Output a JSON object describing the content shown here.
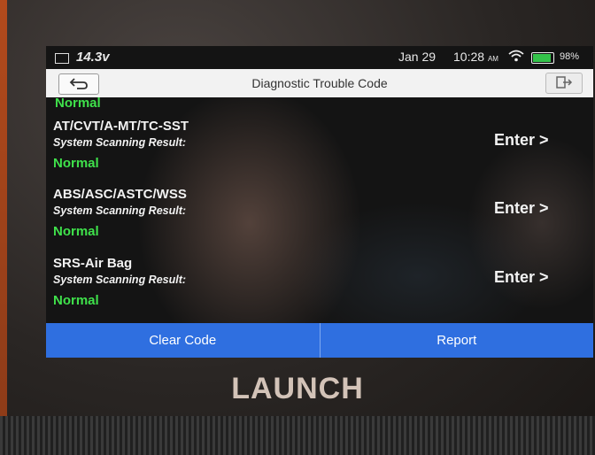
{
  "status_bar": {
    "voltage": "14.3v",
    "date": "Jan 29",
    "time": "10:28",
    "time_suffix": "AM",
    "battery_percent": "98%",
    "battery_level": 0.98
  },
  "title_bar": {
    "title": "Diagnostic Trouble Code"
  },
  "list": {
    "partial_status": "Normal",
    "items": [
      {
        "name": "AT/CVT/A-MT/TC-SST",
        "label": "System Scanning Result:",
        "status": "Normal",
        "action": "Enter >"
      },
      {
        "name": "ABS/ASC/ASTC/WSS",
        "label": "System Scanning Result:",
        "status": "Normal",
        "action": "Enter >"
      },
      {
        "name": "SRS-Air Bag",
        "label": "System Scanning Result:",
        "status": "Normal",
        "action": "Enter >"
      }
    ]
  },
  "bottom_bar": {
    "clear_code": "Clear Code",
    "report": "Report"
  },
  "device": {
    "brand": "LAUNCH"
  },
  "colors": {
    "normal_status": "#3fe14b",
    "button_blue": "#2f6fe0",
    "title_bar_bg": "#f2f2f2"
  }
}
